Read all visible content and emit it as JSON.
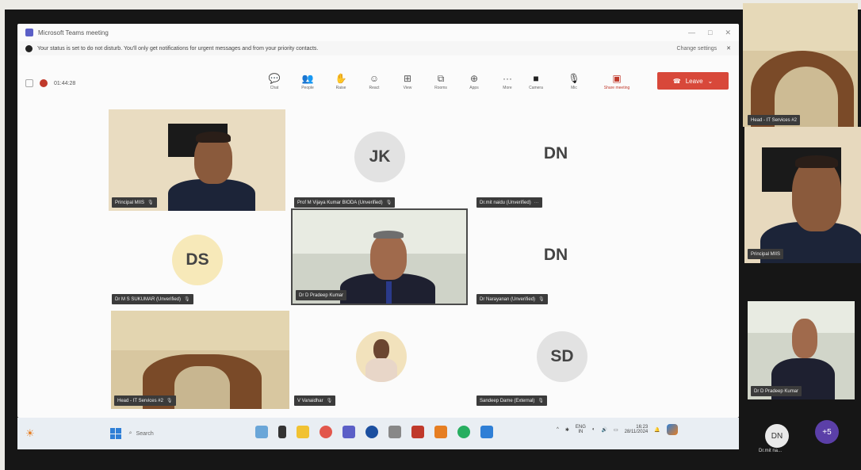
{
  "window": {
    "title": "Microsoft Teams meeting",
    "controls": [
      "—",
      "□",
      "✕"
    ]
  },
  "notice": {
    "text": "Your status is set to do not disturb. You'll only get notifications for urgent messages and from your priority contacts.",
    "change_settings": "Change settings",
    "close": "✕"
  },
  "meeting": {
    "timer": "01:44:28"
  },
  "toolbar": {
    "items": [
      {
        "label": "Chat",
        "icon": "chat-icon",
        "glyph": "💬"
      },
      {
        "label": "People",
        "icon": "people-icon",
        "glyph": "👥"
      },
      {
        "label": "Raise",
        "icon": "raise-hand-icon",
        "glyph": "✋"
      },
      {
        "label": "React",
        "icon": "react-icon",
        "glyph": "☺"
      },
      {
        "label": "View",
        "icon": "view-icon",
        "glyph": "⊞"
      },
      {
        "label": "Rooms",
        "icon": "rooms-icon",
        "glyph": "⧉"
      },
      {
        "label": "Apps",
        "icon": "apps-icon",
        "glyph": "⊕"
      },
      {
        "label": "More",
        "icon": "more-icon",
        "glyph": "···"
      }
    ],
    "camera_label": "Camera",
    "mic_label": "Mic",
    "share_label": "Share meeting",
    "leave_label": "Leave"
  },
  "tiles": [
    {
      "id": "principal",
      "name": "Principal MIIS",
      "type": "video"
    },
    {
      "id": "jk",
      "initials": "JK",
      "name": "Prof M Vijaya Kumar BIODA (Unverified)",
      "type": "avatar"
    },
    {
      "id": "dn1",
      "initials": "DN",
      "name": "Dr.mit naidu (Unverified)",
      "type": "avatar"
    },
    {
      "id": "ds",
      "initials": "DS",
      "name": "Dr M S SUKUMAR (Unverified)",
      "type": "avatar"
    },
    {
      "id": "pradeep",
      "name": "Dr D Pradeep Kumar",
      "type": "video"
    },
    {
      "id": "dn2",
      "initials": "DN",
      "name": "Dr Narayanan (Unverified)",
      "type": "avatar"
    },
    {
      "id": "ithead",
      "name": "Head - IT Services #2",
      "type": "video"
    },
    {
      "id": "vanaidhar",
      "name": "V Vanaidhar",
      "type": "photo"
    },
    {
      "id": "sd",
      "initials": "SD",
      "name": "Sandeep Dame (External)",
      "type": "avatar"
    }
  ],
  "side_panel": {
    "tiles": [
      {
        "name": "Head - IT Services #2"
      },
      {
        "name": "Principal MIIS"
      },
      {
        "name": "Dr D Pradeep Kumar"
      }
    ],
    "bottom_avatar": {
      "initials": "DN",
      "name": "Dr.mit na..."
    },
    "overflow": "+5"
  },
  "taskbar": {
    "search_label": "Search",
    "language": "ENG",
    "region": "IN",
    "time": "16:23",
    "date": "28/11/2024"
  },
  "colors": {
    "leave": "#d8483a",
    "teams_purple": "#5b5fc7",
    "overflow_circle": "#5b3fa8"
  }
}
